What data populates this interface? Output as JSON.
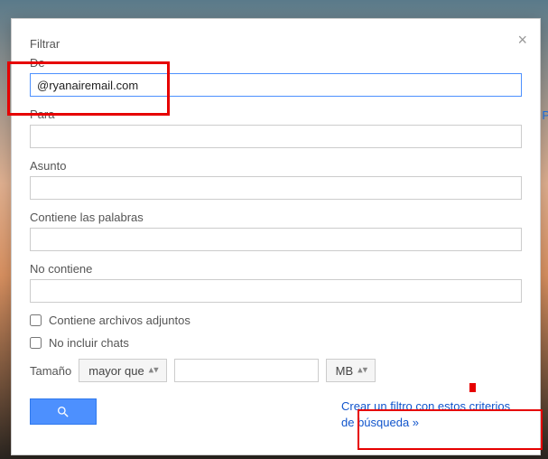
{
  "dialog": {
    "title": "Filtrar",
    "close_label": "×"
  },
  "fields": {
    "from": {
      "label": "De",
      "value": "@ryanairemail.com"
    },
    "to": {
      "label": "Para",
      "value": ""
    },
    "subject": {
      "label": "Asunto",
      "value": ""
    },
    "hasWords": {
      "label": "Contiene las palabras",
      "value": ""
    },
    "doesntHave": {
      "label": "No contiene",
      "value": ""
    }
  },
  "checkboxes": {
    "hasAttachment": {
      "label": "Contiene archivos adjuntos",
      "checked": false
    },
    "excludeChats": {
      "label": "No incluir chats",
      "checked": false
    }
  },
  "size": {
    "label": "Tamaño",
    "operator": "mayor que",
    "value": "",
    "unit": "MB"
  },
  "actions": {
    "create_filter": "Crear un filtro con estos criterios de búsqueda »"
  },
  "bg": {
    "letter": "P"
  }
}
